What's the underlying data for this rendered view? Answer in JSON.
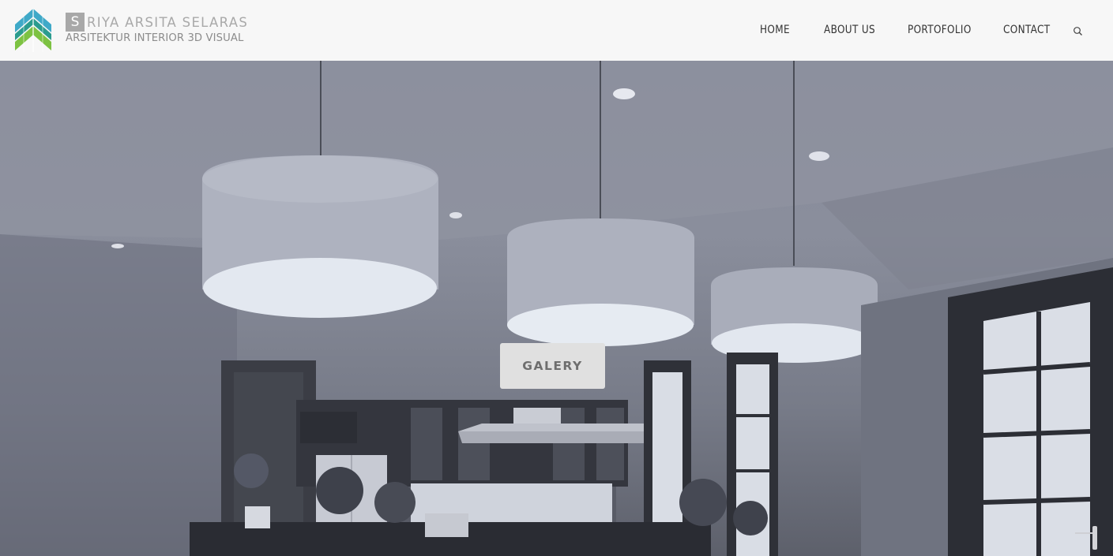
{
  "brand": {
    "initial": "S",
    "name_rest": "RIYA ARSITA SELARAS",
    "tagline": "ARSITEKTUR INTERIOR 3D VISUAL",
    "logo_colors": [
      "#3fa9c8",
      "#2b9c8e",
      "#7dc242"
    ]
  },
  "nav": {
    "items": [
      {
        "label": "HOME"
      },
      {
        "label": "ABOUT US"
      },
      {
        "label": "PORTOFOLIO"
      },
      {
        "label": "CONTACT"
      }
    ],
    "search_icon": "search-icon"
  },
  "hero": {
    "image": "kitchen-interior-render-with-pendant-lamps",
    "button_label": "GALERY"
  },
  "colors": {
    "header_bg": "#f7f7f7",
    "nav_text": "#333333",
    "brand_text": "#a9a9a9",
    "button_bg": "#e0e0e0"
  }
}
